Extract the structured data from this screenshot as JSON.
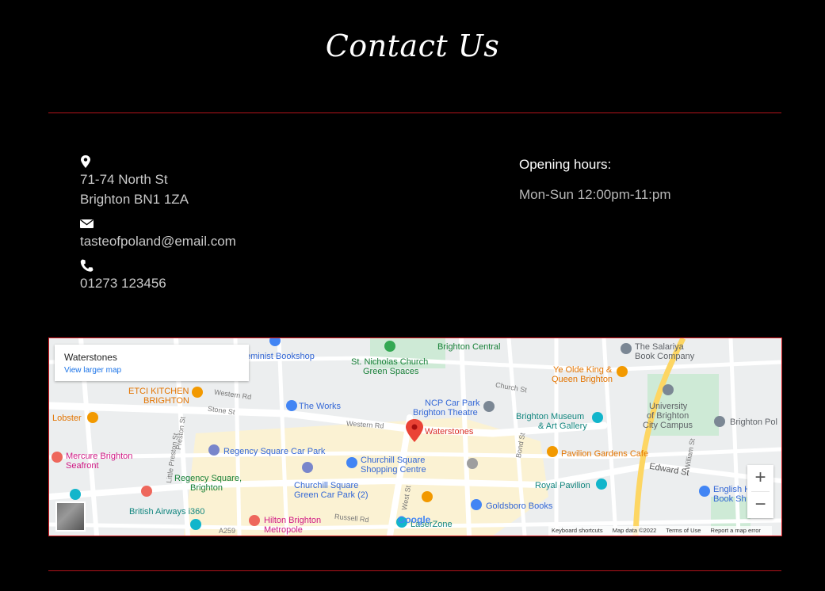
{
  "page": {
    "title": "Contact Us"
  },
  "contact": {
    "address_line1": "71-74 North St",
    "address_line2": "Brighton BN1 1ZA",
    "email": "tasteofpoland@email.com",
    "phone": "01273 123456"
  },
  "hours": {
    "label": "Opening hours:",
    "value": "Mon-Sun 12:00pm-11:pm"
  },
  "map": {
    "place_name": "Waterstones",
    "larger_map_link": "View larger map",
    "zoom_in": "+",
    "zoom_out": "−",
    "google_logo": "Google",
    "attribution": {
      "shortcuts": "Keyboard shortcuts",
      "data": "Map data ©2022",
      "terms": "Terms of Use",
      "report": "Report a map error"
    },
    "labels": {
      "bookshop": "eminist Bookshop",
      "st_nicholas_1": "St. Nicholas Church",
      "st_nicholas_2": "Green Spaces",
      "brighton_central": "Brighton Central",
      "salariya_1": "The Salariya",
      "salariya_2": "Book Company",
      "ye_olde_1": "Ye Olde King &",
      "ye_olde_2": "Queen Brighton",
      "etci_1": "ETCI KITCHEN",
      "etci_2": "BRIGHTON",
      "lobster": "Lobster",
      "the_works": "The Works",
      "ncp_1": "NCP Car Park",
      "ncp_2": "Brighton Theatre",
      "waterstones": "Waterstones",
      "museum_1": "Brighton Museum",
      "museum_2": "& Art Gallery",
      "university_1": "University",
      "university_2": "of Brighton",
      "university_3": "City Campus",
      "brighton_pol": "Brighton Pol",
      "mercure_1": "Mercure Brighton",
      "mercure_2": "Seafront",
      "regency_car": "Regency Square Car Park",
      "churchill_1": "Churchill Square",
      "churchill_2": "Shopping Centre",
      "pavilion_gardens": "Pavilion Gardens Cafe",
      "regency_sq_1": "Regency Square,",
      "regency_sq_2": "Brighton",
      "churchill_car_1": "Churchill Square",
      "churchill_car_2": "Green Car Park (2)",
      "royal_pavilion": "Royal Pavilion",
      "english_1": "English H",
      "english_2": "Book Sh",
      "british_airways": "British Airways i360",
      "hilton_1": "Hilton Brighton",
      "hilton_2": "Metropole",
      "laserzone": "LaserZone",
      "goldsboro": "Goldsboro Books",
      "edward_st": "Edward St",
      "western_rd": "Western Rd",
      "western_rd2": "Western Rd",
      "stone_st": "Stone St",
      "preston_st": "Preston St",
      "little_preston": "Little Preston St",
      "west_st": "West St",
      "russell_rd": "Russell Rd",
      "church_st": "Church St",
      "bond_st": "Bond St",
      "william_st": "William St",
      "a259": "A259"
    }
  }
}
